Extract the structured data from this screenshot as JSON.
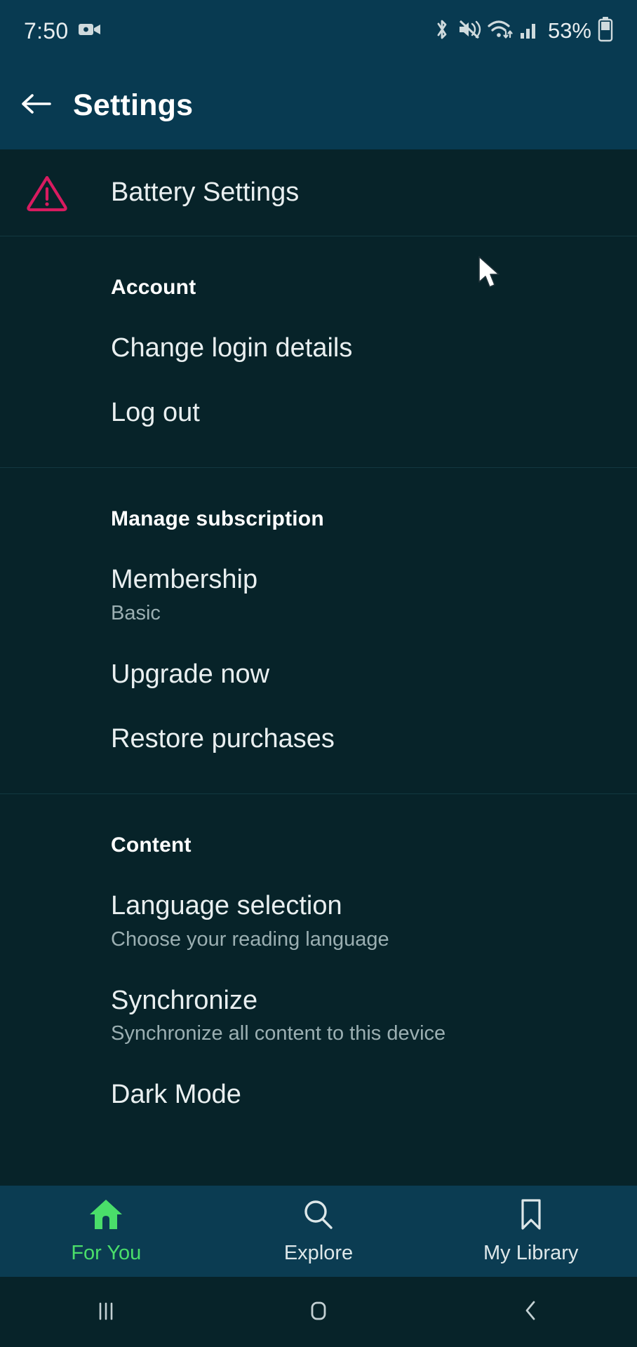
{
  "status_bar": {
    "time": "7:50",
    "battery_percent": "53%",
    "icons": [
      "video-camera-icon",
      "bluetooth-icon",
      "vibrate-mute-icon",
      "wifi-icon",
      "cellular-signal-icon",
      "battery-icon"
    ]
  },
  "app_bar": {
    "back_label": "back-arrow",
    "title": "Settings"
  },
  "battery_row": {
    "label": "Battery Settings",
    "icon": "warning-triangle-icon",
    "icon_color": "#D81B60"
  },
  "sections": [
    {
      "header": "Account",
      "items": [
        {
          "title": "Change login details",
          "subtitle": ""
        },
        {
          "title": "Log out",
          "subtitle": ""
        }
      ]
    },
    {
      "header": "Manage subscription",
      "items": [
        {
          "title": "Membership",
          "subtitle": "Basic"
        },
        {
          "title": "Upgrade now",
          "subtitle": ""
        },
        {
          "title": "Restore purchases",
          "subtitle": ""
        }
      ]
    },
    {
      "header": "Content",
      "items": [
        {
          "title": "Language selection",
          "subtitle": "Choose your reading language"
        },
        {
          "title": "Synchronize",
          "subtitle": "Synchronize all content to this device"
        },
        {
          "title": "Dark Mode",
          "subtitle": ""
        }
      ]
    }
  ],
  "bottom_nav": {
    "active_color": "#4ADE6A",
    "items": [
      {
        "label": "For You",
        "icon": "home-icon",
        "active": true
      },
      {
        "label": "Explore",
        "icon": "search-icon",
        "active": false
      },
      {
        "label": "My Library",
        "icon": "bookmark-icon",
        "active": false
      }
    ]
  },
  "android_nav": {
    "items": [
      {
        "name": "recents-button"
      },
      {
        "name": "home-button"
      },
      {
        "name": "back-button"
      }
    ]
  },
  "colors": {
    "header_bg": "#083A51",
    "content_bg": "#072329",
    "nav_bg": "#0B3C52",
    "accent_green": "#4ADE6A",
    "warning": "#D81B60"
  }
}
